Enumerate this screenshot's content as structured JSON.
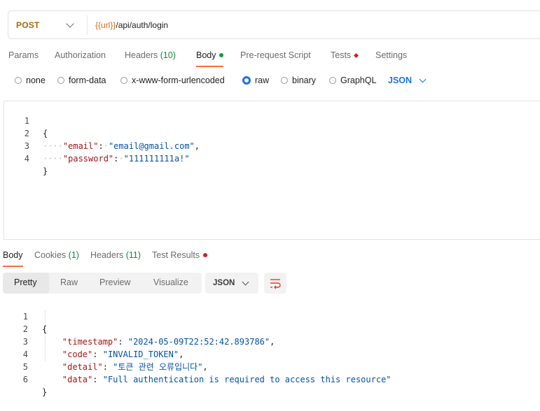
{
  "request": {
    "method": "POST",
    "url_var": "{{url}}",
    "url_path": "/api/auth/login"
  },
  "request_tabs": [
    {
      "label": "Params"
    },
    {
      "label": "Authorization"
    },
    {
      "label": "Headers",
      "count": "(10)"
    },
    {
      "label": "Body",
      "active": true
    },
    {
      "label": "Pre-request Script"
    },
    {
      "label": "Tests"
    },
    {
      "label": "Settings"
    }
  ],
  "body_modes": [
    "none",
    "form-data",
    "x-www-form-urlencoded",
    "raw",
    "binary",
    "GraphQL"
  ],
  "body_mode_selected": "raw",
  "body_format": "JSON",
  "request_body": {
    "line_numbers": [
      "1",
      "2",
      "3",
      "4"
    ],
    "open_brace": "{",
    "close_brace": "}",
    "email_key": "\"email\"",
    "email_value": "\"email@gmail.com\"",
    "password_key": "\"password\"",
    "password_value": "\"111111111a!\""
  },
  "response_tabs": [
    {
      "label": "Body",
      "active": true
    },
    {
      "label": "Cookies",
      "count": "(1)"
    },
    {
      "label": "Headers",
      "count": "(11)"
    },
    {
      "label": "Test Results"
    }
  ],
  "view_modes": [
    "Pretty",
    "Raw",
    "Preview",
    "Visualize"
  ],
  "view_mode_selected": "Pretty",
  "response_format": "JSON",
  "response_body": {
    "line_numbers": [
      "1",
      "2",
      "3",
      "4",
      "5",
      "6"
    ],
    "open_brace": "{",
    "close_brace": "}",
    "timestamp_key": "\"timestamp\"",
    "timestamp_value": "\"2024-05-09T22:52:42.893786\"",
    "code_key": "\"code\"",
    "code_value": "\"INVALID_TOKEN\"",
    "detail_key": "\"detail\"",
    "detail_value": "\"토큰 관련 오류입니다\"",
    "data_key": "\"data\"",
    "data_value": "\"Full authentication is required to access this resource\""
  },
  "colors": {
    "accent": "#ff6c37",
    "method": "#a86a00",
    "url_var": "#e06a1a",
    "link_blue": "#1a73e8",
    "count_green": "#0f8a3a",
    "json_key": "#a31515",
    "json_string": "#0451a5"
  }
}
